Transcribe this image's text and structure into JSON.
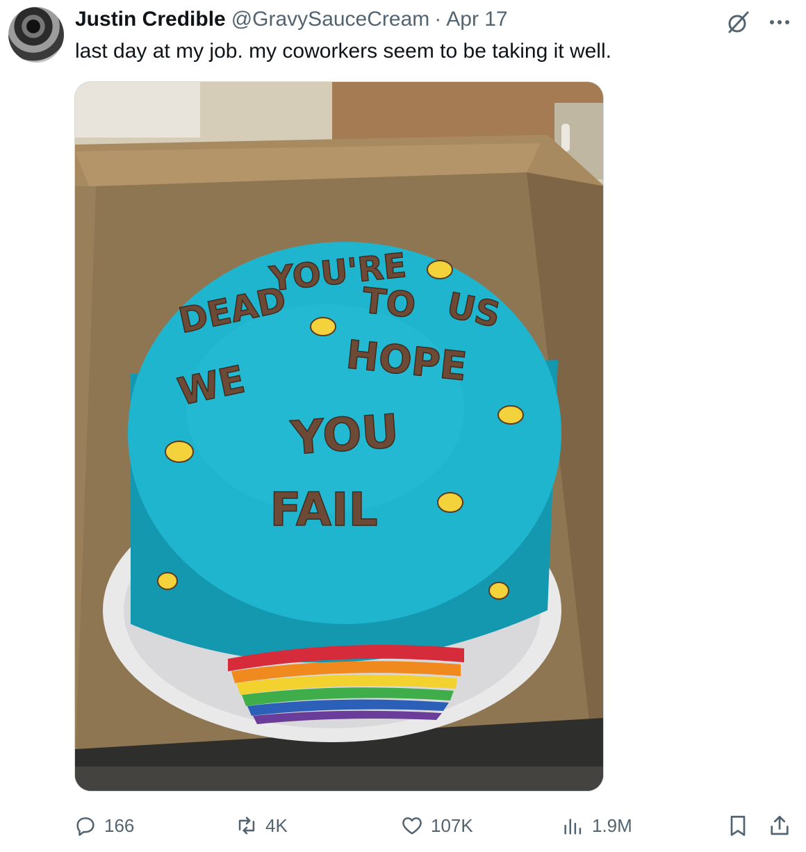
{
  "author": {
    "name": "Justin Credible",
    "handle": "@GravySauceCream",
    "separator": "·",
    "date": "Apr 17"
  },
  "tweet": {
    "text": "last day at my job. my coworkers seem to be taking it well."
  },
  "media": {
    "cake_text": [
      "YOU'RE",
      "DEAD",
      "TO",
      "US",
      "WE",
      "HOPE",
      "YOU",
      "FAIL"
    ],
    "cake_color": "#1fb5cf"
  },
  "actions": {
    "replies": "166",
    "reposts": "4K",
    "likes": "107K",
    "views": "1.9M"
  },
  "icons": {
    "reply": "reply-icon",
    "repost": "repost-icon",
    "like": "heart-icon",
    "views": "views-chart-icon",
    "bookmark": "bookmark-icon",
    "share": "share-icon",
    "grok": "grok-icon",
    "more": "more-icon"
  },
  "colors": {
    "text_primary": "#0f1419",
    "text_secondary": "#536471"
  }
}
